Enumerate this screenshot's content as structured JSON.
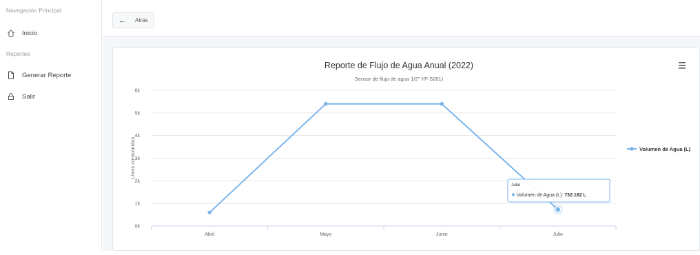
{
  "sidebar": {
    "nav_heading": "Navegación Principal",
    "inicio_label": "Inicio",
    "reports_heading": "Reportes",
    "generar_label": "Generar Reporte",
    "salir_label": "Salir"
  },
  "topbar": {
    "back_label": "Atras"
  },
  "chart_menu_icon": "hamburger-menu-icon",
  "chart_data": {
    "type": "line",
    "title": "Reporte de Flujo de Agua Anual (2022)",
    "subtitle": "Sensor de flujo de agua 1/2\" YF-S201)",
    "xlabel": "",
    "ylabel": "Litros consumidos",
    "categories": [
      "Abril",
      "Mayo",
      "Junio",
      "Julio"
    ],
    "yticks": [
      "0k",
      "1k",
      "2k",
      "3k",
      "4k",
      "5k",
      "6k"
    ],
    "ylim": [
      0,
      6000
    ],
    "grid": true,
    "legend_position": "right",
    "series": [
      {
        "name": "Volumen de Agua (L)",
        "values": [
          600,
          5400,
          5400,
          732.182
        ],
        "color": "#7cb5ec"
      }
    ],
    "tooltip": {
      "header": "Julio",
      "series_label": "Volumen de Agua (L):",
      "value": "732.182 L"
    }
  }
}
